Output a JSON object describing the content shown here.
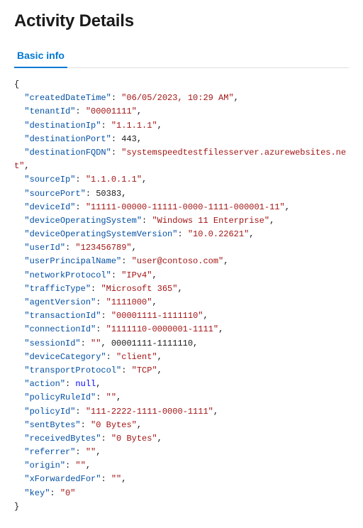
{
  "header": {
    "title": "Activity Details"
  },
  "tabs": [
    {
      "id": "basic-info",
      "label": "Basic info",
      "active": true
    }
  ],
  "json_content": {
    "fields": [
      {
        "key": "createdDateTime",
        "value": "\"06/05/2023, 10:29 AM\"",
        "type": "string"
      },
      {
        "key": "tenantId",
        "value": "\"00001111\"",
        "type": "string"
      },
      {
        "key": "destinationIp",
        "value": "\"1.1.1.1\"",
        "type": "string"
      },
      {
        "key": "destinationPort",
        "value": "443",
        "type": "number"
      },
      {
        "key": "destinationFQDN",
        "value": "\"systemspeedtestfilesserver.azurewebsites.net\"",
        "type": "string"
      },
      {
        "key": "sourceIp",
        "value": "\"1.1.0.1.1\"",
        "type": "string"
      },
      {
        "key": "sourcePort",
        "value": "50383",
        "type": "number"
      },
      {
        "key": "deviceId",
        "value": "\"11111-00000-11111-0000-1111-000001-11\"",
        "type": "string"
      },
      {
        "key": "deviceOperatingSystem",
        "value": "\"Windows 11 Enterprise\"",
        "type": "string"
      },
      {
        "key": "deviceOperatingSystemVersion",
        "value": "\"10.0.22621\"",
        "type": "string"
      },
      {
        "key": "userId",
        "value": "\"123456789\"",
        "type": "string"
      },
      {
        "key": "userPrincipalName",
        "value": "\"user@contoso.com\"",
        "type": "string"
      },
      {
        "key": "networkProtocol",
        "value": "\"IPv4\"",
        "type": "string"
      },
      {
        "key": "trafficType",
        "value": "\"Microsoft 365\"",
        "type": "string"
      },
      {
        "key": "agentVersion",
        "value": "\"1111000\"",
        "type": "string"
      },
      {
        "key": "transactionId",
        "value": "\"00001111-1111110\"",
        "type": "string"
      },
      {
        "key": "connectionId",
        "value": "\"1111110-0000001-1111\"",
        "type": "string"
      },
      {
        "key": "sessionId",
        "value": "\"\", 00001111-1111110",
        "type": "mixed"
      },
      {
        "key": "deviceCategory",
        "value": "\"client\"",
        "type": "string"
      },
      {
        "key": "transportProtocol",
        "value": "\"TCP\"",
        "type": "string"
      },
      {
        "key": "action",
        "value": "null",
        "type": "null"
      },
      {
        "key": "policyRuleId",
        "value": "\"\"",
        "type": "string"
      },
      {
        "key": "policyId",
        "value": "\"111-2222-1111-0000-1111\"",
        "type": "string"
      },
      {
        "key": "sentBytes",
        "value": "\"0 Bytes\"",
        "type": "string"
      },
      {
        "key": "receivedBytes",
        "value": "\"0 Bytes\"",
        "type": "string"
      },
      {
        "key": "referrer",
        "value": "\"\"",
        "type": "string"
      },
      {
        "key": "origin",
        "value": "\"\"",
        "type": "string"
      },
      {
        "key": "xForwardedFor",
        "value": "\"\"",
        "type": "string"
      },
      {
        "key": "key",
        "value": "\"0\"",
        "type": "string"
      }
    ]
  }
}
